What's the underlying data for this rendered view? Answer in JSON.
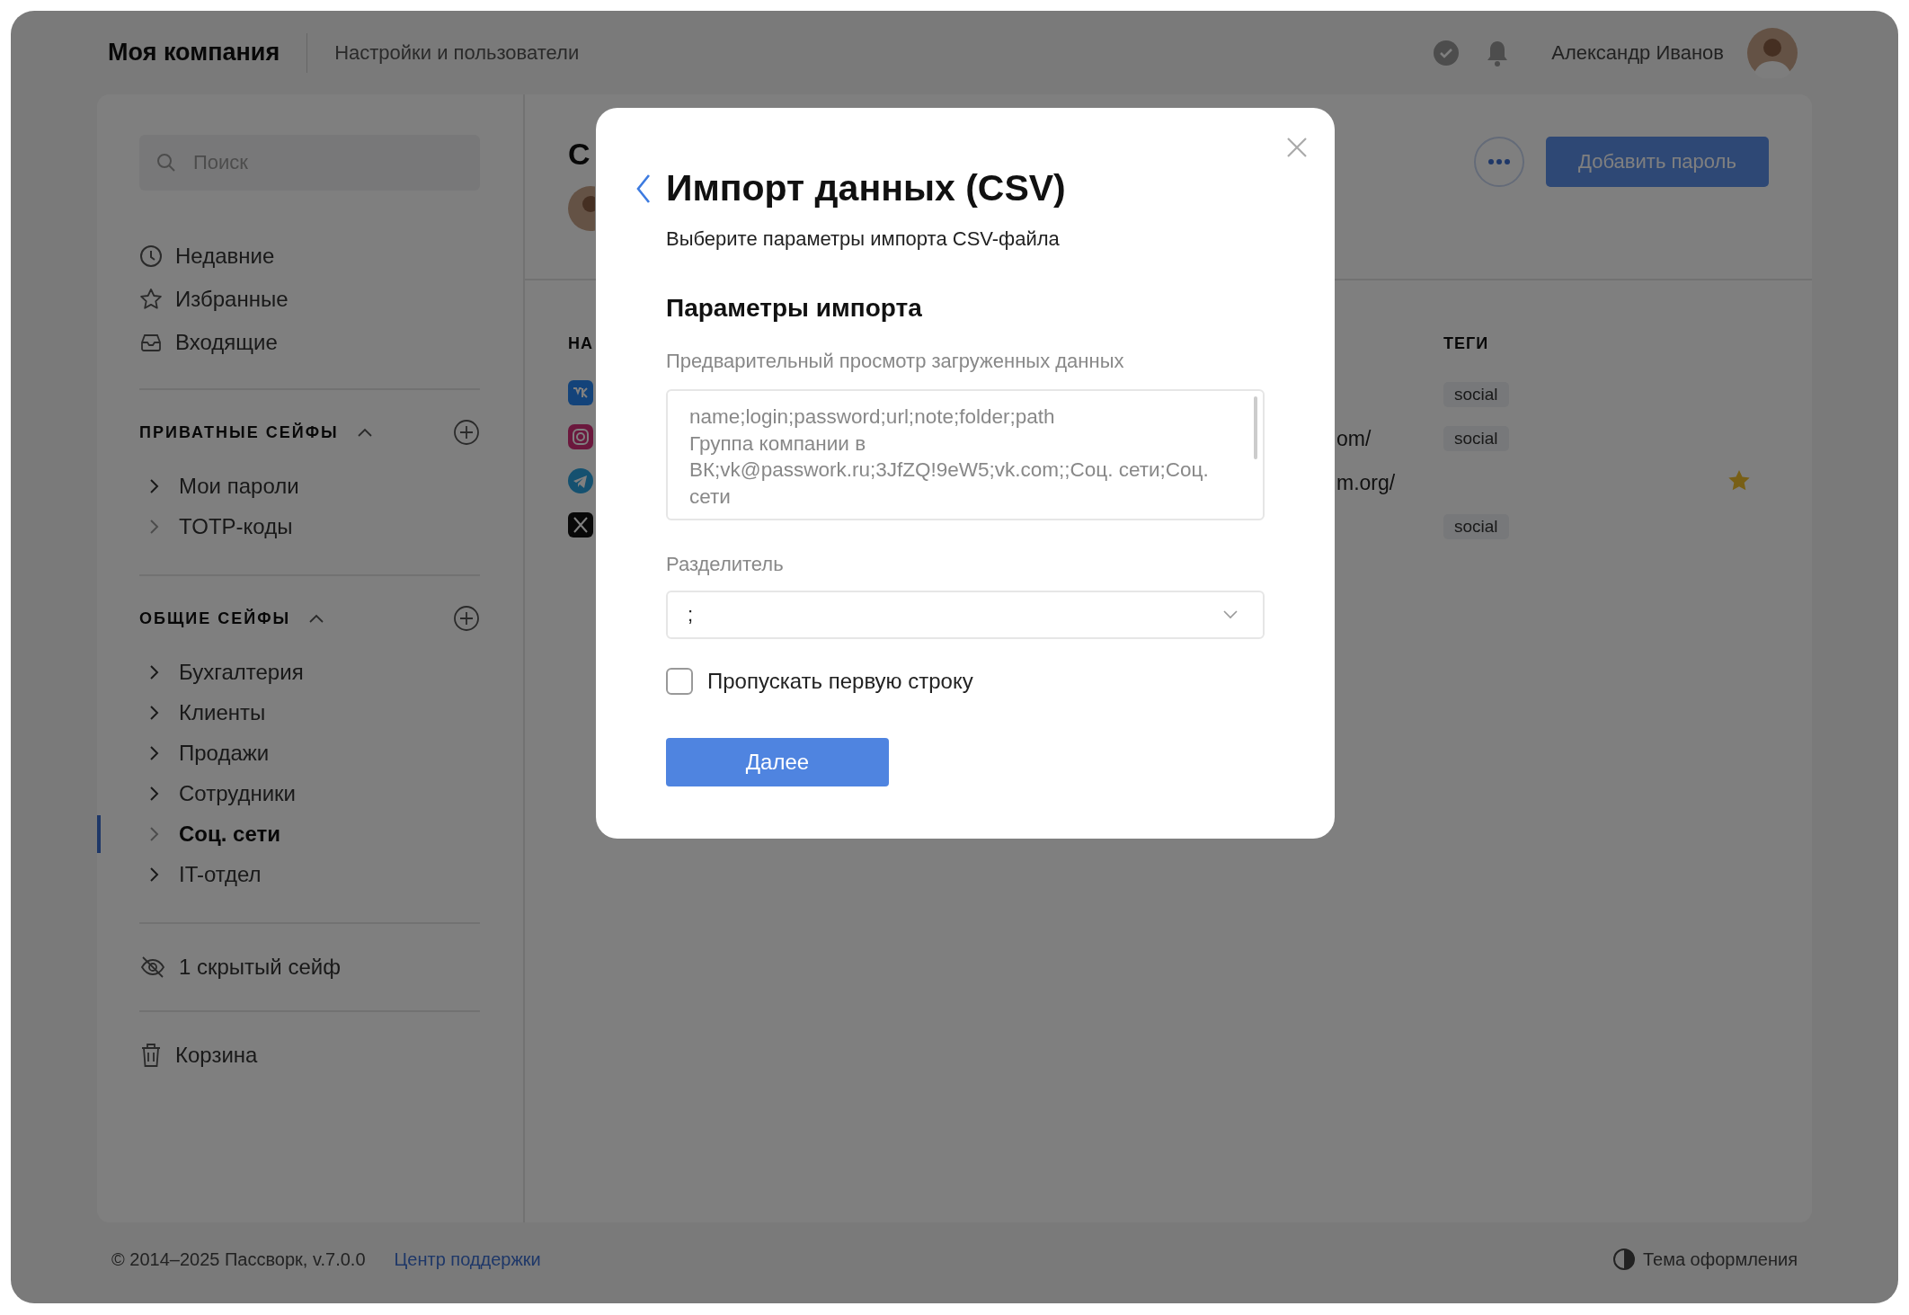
{
  "header": {
    "company": "Моя компания",
    "section": "Настройки и пользователи",
    "user": "Александр Иванов"
  },
  "search": {
    "placeholder": "Поиск"
  },
  "nav": [
    {
      "kind": "recent",
      "label": "Недавние"
    },
    {
      "kind": "favorites",
      "label": "Избранные"
    },
    {
      "kind": "inbox",
      "label": "Входящие"
    }
  ],
  "vault_groups": [
    {
      "title": "ПРИВАТНЫЕ СЕЙФЫ",
      "expanded": true,
      "items": [
        {
          "label": "Мои пароли",
          "expandable": true,
          "selected": false
        },
        {
          "label": "TOTP-коды",
          "expandable": false,
          "selected": false
        }
      ]
    },
    {
      "title": "ОБЩИЕ СЕЙФЫ",
      "expanded": true,
      "items": [
        {
          "label": "Бухгалтерия",
          "expandable": true,
          "selected": false
        },
        {
          "label": "Клиенты",
          "expandable": true,
          "selected": false
        },
        {
          "label": "Продажи",
          "expandable": true,
          "selected": false
        },
        {
          "label": "Сотрудники",
          "expandable": true,
          "selected": false
        },
        {
          "label": "Соц. сети",
          "expandable": false,
          "selected": true
        },
        {
          "label": "IT-отдел",
          "expandable": true,
          "selected": false
        }
      ]
    }
  ],
  "hidden_vaults": "1 скрытый сейф",
  "trash": "Корзина",
  "content": {
    "title": "С",
    "add_button": "Добавить пароль",
    "table": {
      "columns": [
        "НА",
        "ТЕГИ"
      ],
      "rows": [
        {
          "kind": "vk",
          "url": "",
          "tags": [
            "social"
          ],
          "favorite": false
        },
        {
          "kind": "instagram",
          "url": "om/",
          "tags": [
            "social"
          ],
          "favorite": false
        },
        {
          "kind": "telegram",
          "url": "m.org/",
          "tags": [],
          "favorite": true
        },
        {
          "kind": "x",
          "url": "",
          "tags": [
            "social"
          ],
          "favorite": false
        }
      ]
    }
  },
  "footer": {
    "copyright": "© 2014–2025 Пассворк, v.7.0.0",
    "support_link": "Центр поддержки",
    "theme": "Тема оформления"
  },
  "dialog": {
    "title": "Импорт данных (CSV)",
    "subtitle": "Выберите параметры импорта CSV-файла",
    "section": "Параметры импорта",
    "preview_label": "Предварительный просмотр загруженных данных",
    "preview": "name;login;password;url;note;folder;path\nГруппа компании в ВК;vk@passwork.ru;3JfZQ!9eW5;vk.com;;Соц. сети;Соц. сети",
    "separator_label": "Разделитель",
    "separator": ";",
    "skip_first_row": {
      "label": "Пропускать первую строку",
      "checked": false
    },
    "next_button": "Далее"
  }
}
